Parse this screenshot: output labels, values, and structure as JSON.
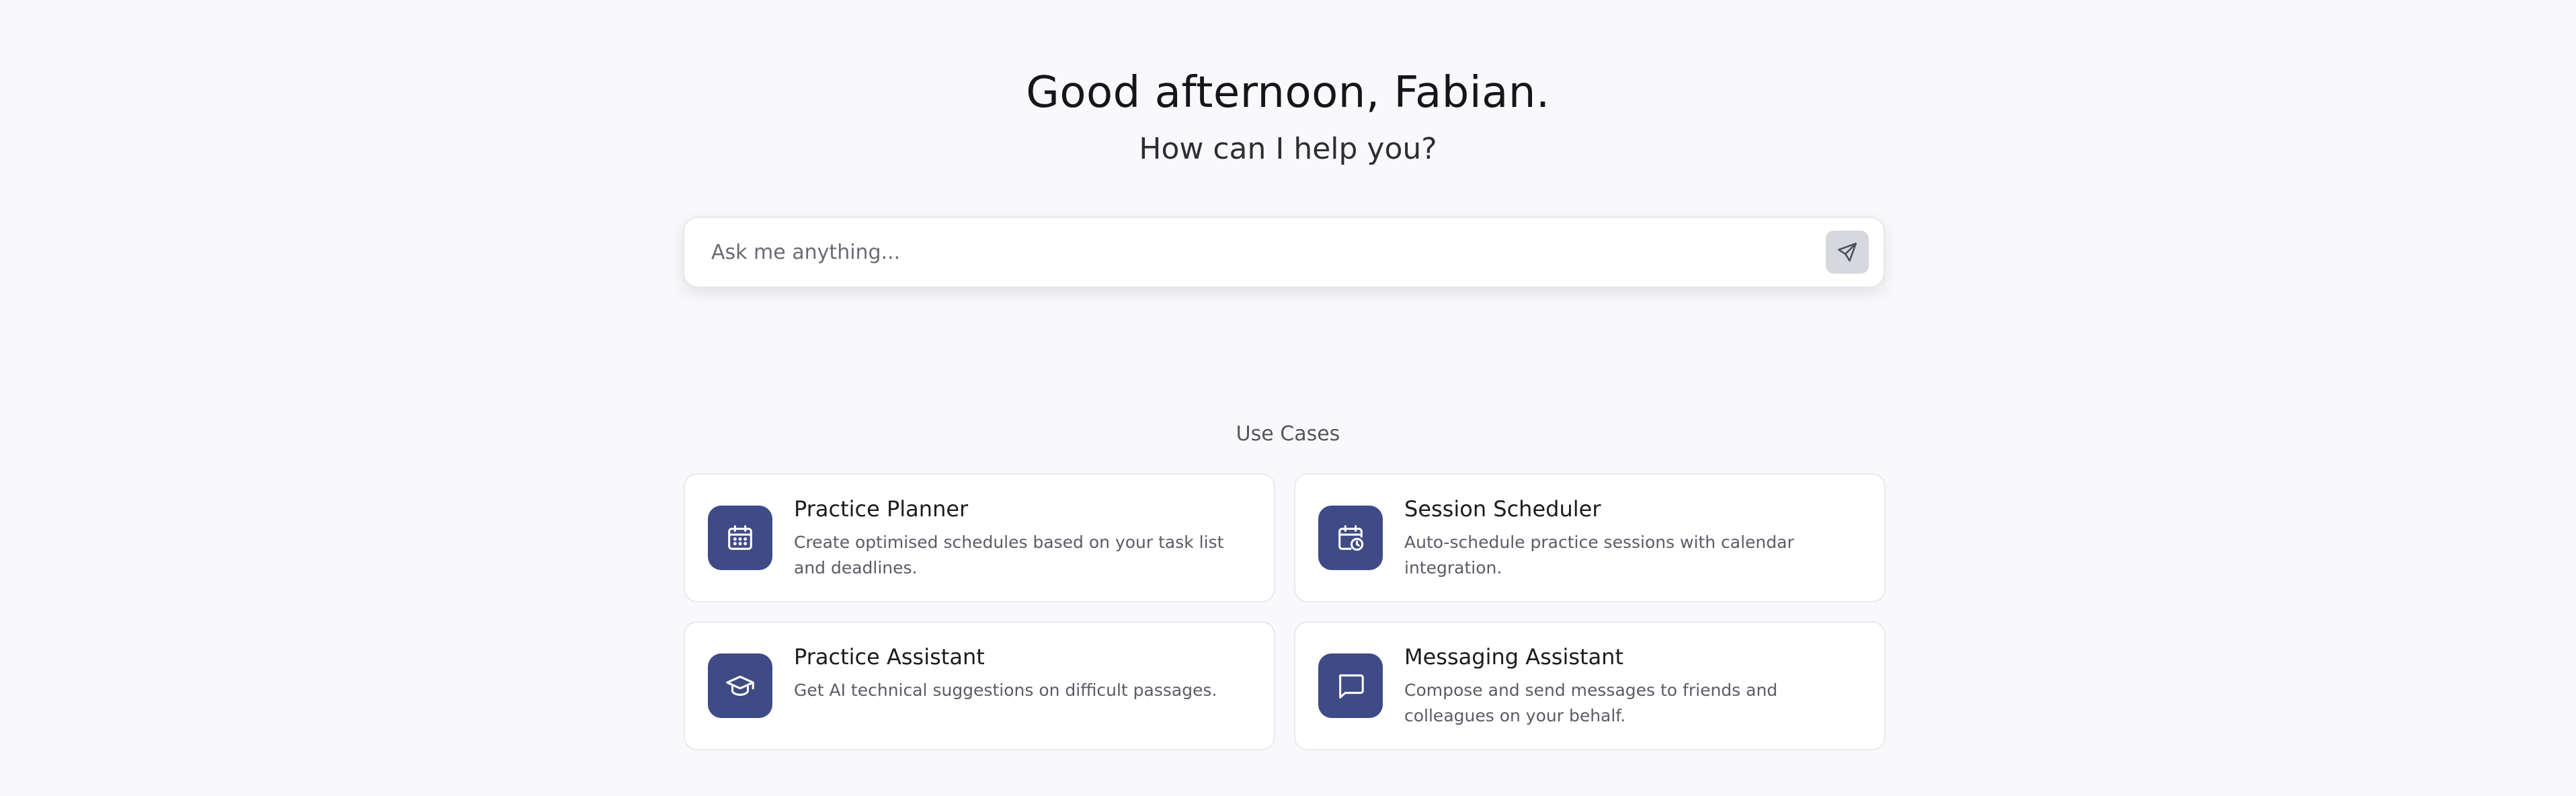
{
  "header": {
    "greeting": "Good afternoon, Fabian.",
    "subtitle": "How can I help you?"
  },
  "search": {
    "placeholder": "Ask me anything...",
    "value": "",
    "send_icon": "send-icon"
  },
  "use_cases": {
    "title": "Use Cases",
    "items": [
      {
        "title": "Practice Planner",
        "description": "Create optimised schedules based on your task list and deadlines.",
        "icon": "calendar-icon"
      },
      {
        "title": "Session Scheduler",
        "description": "Auto-schedule practice sessions with calendar integration.",
        "icon": "calendar-clock-icon"
      },
      {
        "title": "Practice Assistant",
        "description": "Get AI technical suggestions on difficult passages.",
        "icon": "graduation-cap-icon"
      },
      {
        "title": "Messaging Assistant",
        "description": "Compose and send messages to friends and colleagues on your behalf.",
        "icon": "message-icon"
      }
    ]
  },
  "colors": {
    "background": "#f9f9fb",
    "icon_tile": "#3f4b86",
    "send_button": "#d6d8de"
  }
}
